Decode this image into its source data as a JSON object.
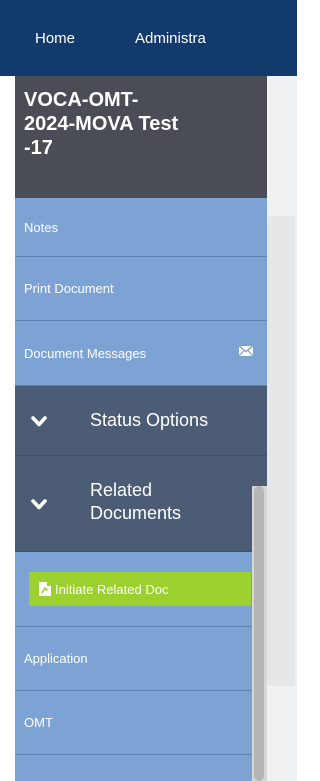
{
  "topnav": {
    "home_label": "Home",
    "admin_label": "Administra"
  },
  "document": {
    "title_line1": "VOCA-OMT-",
    "title_line2": "2024-MOVA Test",
    "title_line3": "-17"
  },
  "sidebar": {
    "notes_label": "Notes",
    "print_label": "Print Document",
    "messages_label": "Document Messages",
    "messages_icon": "envelope-icon",
    "status_label": "Status Options",
    "related_label_line1": "Related",
    "related_label_line2": "Documents",
    "initiate_button_label": "Initiate Related Doc",
    "initiate_icon": "document-icon",
    "application_label": "Application",
    "omt_label": "OMT",
    "chevron_icon": "chevron-down-icon"
  },
  "colors": {
    "nav_bg": "#123a6c",
    "title_bg": "#4a4d56",
    "link_bg": "#7ca3d4",
    "section_bg": "#4b5c74",
    "button_bg": "#9bd02e"
  }
}
